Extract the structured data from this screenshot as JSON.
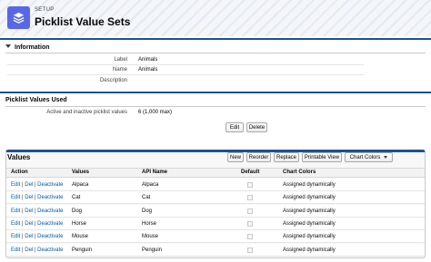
{
  "header": {
    "breadcrumb": "SETUP",
    "title": "Picklist Value Sets",
    "icon": "layers-icon"
  },
  "information": {
    "title": "Information",
    "fields": [
      {
        "label": "Label",
        "value": "Animals"
      },
      {
        "label": "Name",
        "value": "Animals"
      },
      {
        "label": "Description",
        "value": ""
      }
    ]
  },
  "picklist_used": {
    "title": "Picklist Values Used",
    "label": "Active and inactive picklist values",
    "value": "6 (1,000 max)",
    "edit_label": "Edit",
    "delete_label": "Delete"
  },
  "values": {
    "title": "Values",
    "buttons": {
      "new": "New",
      "reorder": "Reorder",
      "replace": "Replace",
      "printable": "Printable View",
      "chart_colors": "Chart Colors"
    },
    "columns": {
      "action": "Action",
      "values": "Values",
      "api_name": "API Name",
      "default": "Default",
      "chart_colors": "Chart Colors"
    },
    "action_links": {
      "edit": "Edit",
      "del": "Del",
      "deactivate": "Deactivate",
      "separator": "|"
    },
    "rows": [
      {
        "value": "Alpaca",
        "api": "Alpaca",
        "default": false,
        "color": "Assigned dynamically"
      },
      {
        "value": "Cat",
        "api": "Cat",
        "default": false,
        "color": "Assigned dynamically"
      },
      {
        "value": "Dog",
        "api": "Dog",
        "default": false,
        "color": "Assigned dynamically"
      },
      {
        "value": "Horse",
        "api": "Horse",
        "default": false,
        "color": "Assigned dynamically"
      },
      {
        "value": "Mouse",
        "api": "Mouse",
        "default": false,
        "color": "Assigned dynamically"
      },
      {
        "value": "Penguin",
        "api": "Penguin",
        "default": false,
        "color": "Assigned dynamically"
      }
    ]
  },
  "colors": {
    "accent": "#1b5297",
    "icon_bg": "#5867e8",
    "link": "#015ba7"
  }
}
